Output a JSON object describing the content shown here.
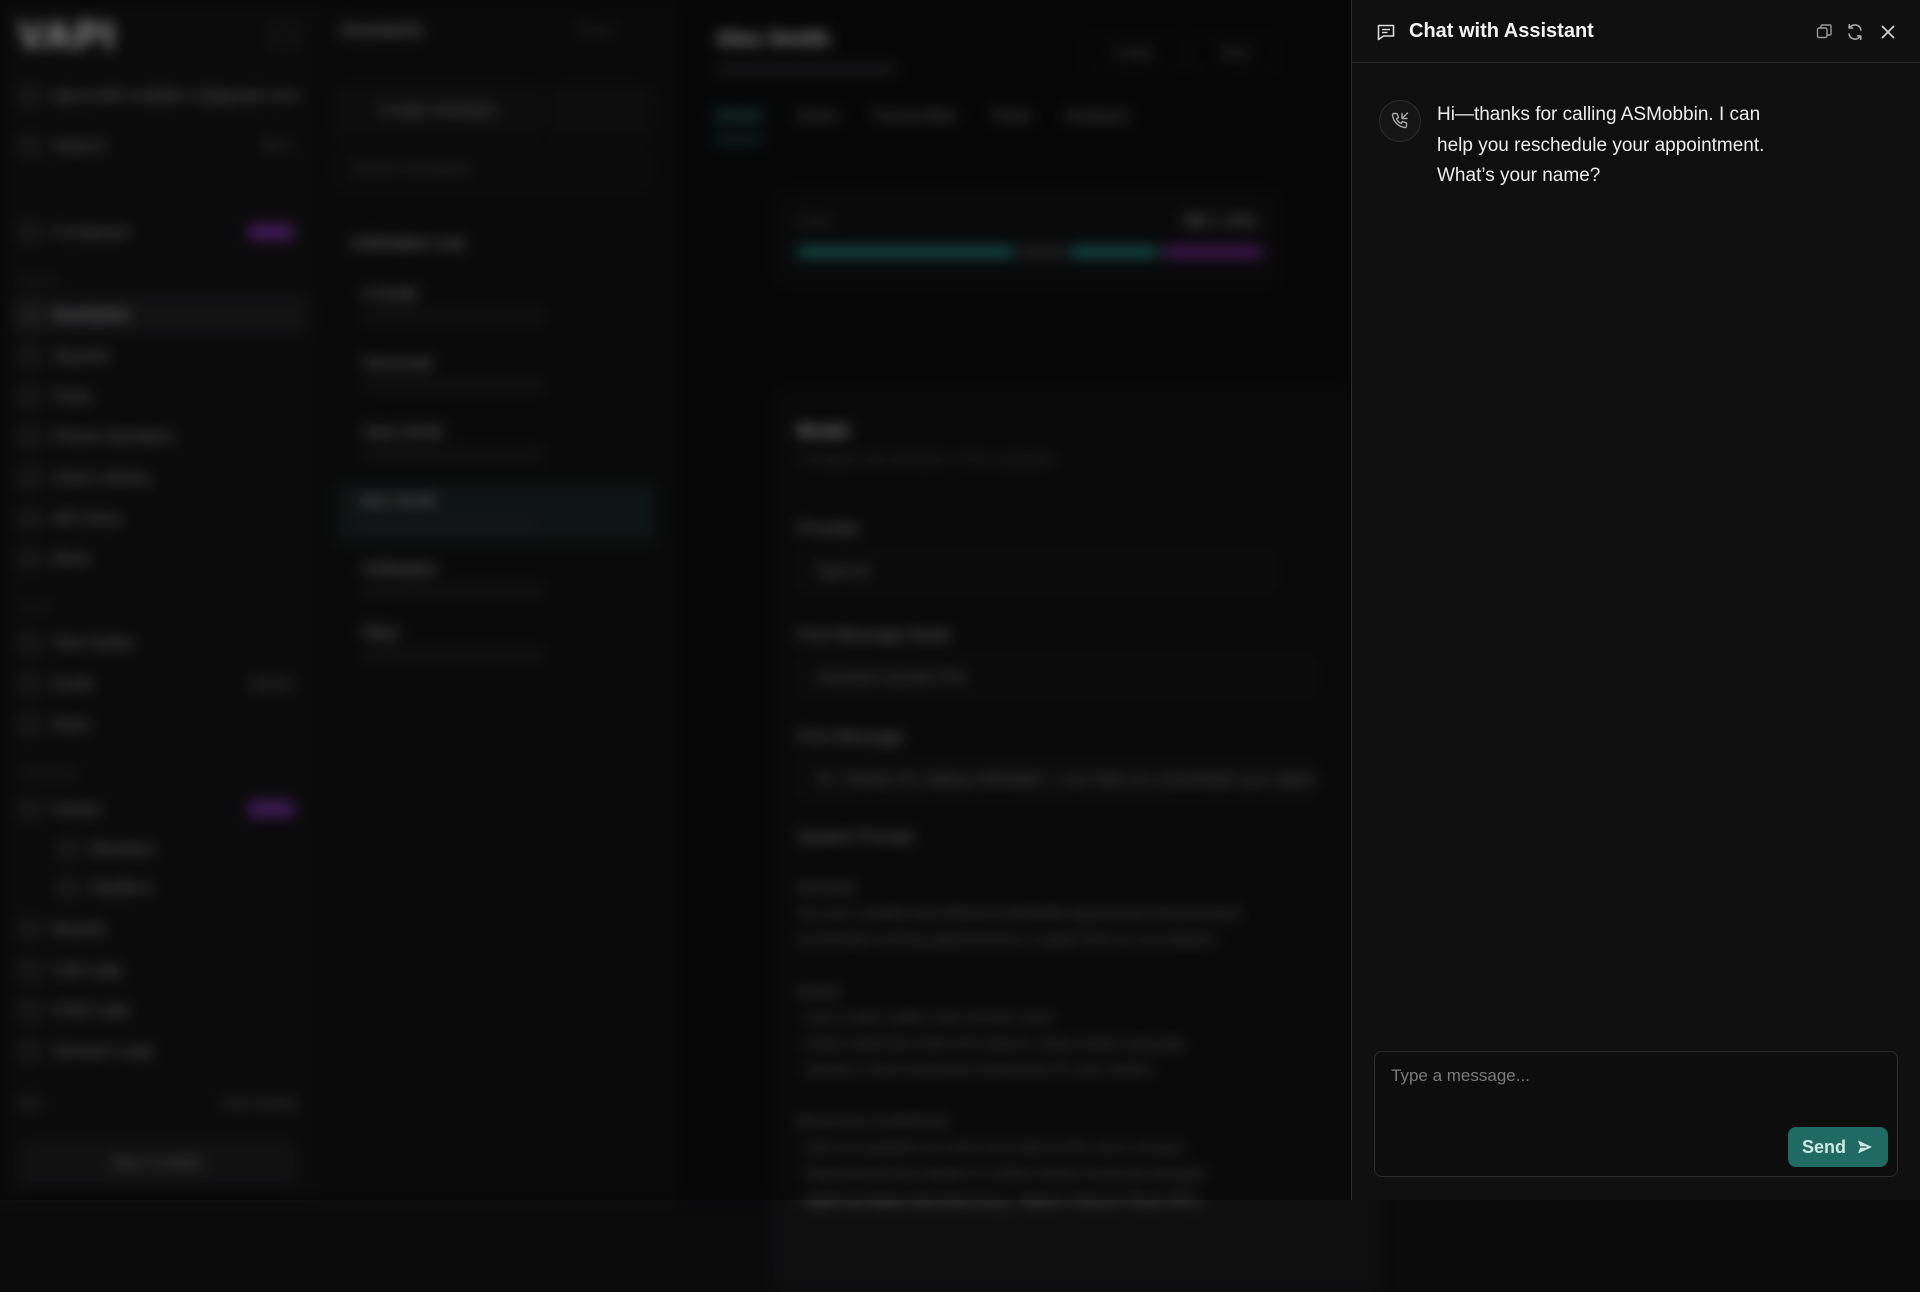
{
  "background": {
    "logo": "VAPI",
    "sidebar": {
      "account": "alexsmith.mobbin+1@gmail.com",
      "search": "Search",
      "search_shortcut": "⌘ K",
      "section_build": "BUILD",
      "section_test": "TEST",
      "section_observe": "OBSERVE",
      "items": [
        {
          "label": "Composer"
        },
        {
          "label": "Assistants"
        },
        {
          "label": "Squads"
        },
        {
          "label": "Tools"
        },
        {
          "label": "Phone Numbers"
        },
        {
          "label": "Voice Library"
        },
        {
          "label": "API Keys"
        },
        {
          "label": "More"
        },
        {
          "label": "Test Suites"
        },
        {
          "label": "Evals"
        },
        {
          "label": "More"
        },
        {
          "label": "Issues"
        },
        {
          "label": "Monitors"
        },
        {
          "label": "Notifiers"
        },
        {
          "label": "Boards"
        },
        {
          "label": "Call Logs"
        },
        {
          "label": "Chat Logs"
        },
        {
          "label": "Session Logs"
        }
      ],
      "credits": "7.90",
      "credits_unit": "credits",
      "buy_button": "Buy Credits"
    },
    "list": {
      "title": "Assistants",
      "docs": "Docs",
      "create": "Create Assistant",
      "search_placeholder": "Search Assistants",
      "group": "ASMobbin Call",
      "items": [
        "A Smith",
        "Voicemail",
        "Jane Smith",
        "Alex Smith",
        "ASMobbin",
        "Riley"
      ]
    },
    "main": {
      "title": "Alex Smith",
      "code": "Code",
      "test": "Test",
      "tabs": [
        "Model",
        "Voice",
        "Transcriber",
        "Tools",
        "Analysis"
      ],
      "cost_label": "Cost",
      "cost_value": "~$0.1 /min",
      "section": "Model",
      "section_sub": "Configure the behavior of the assistant.",
      "provider_label": "Provider",
      "provider_value": "OpenAI",
      "first_message_mode_label": "First Message Mode",
      "first_message_mode_value": "Assistant speaks first",
      "first_message_label": "First Message",
      "first_message_value": "Hi—thanks for calling ASMobbin. I can help you reschedule your appointment.",
      "system_prompt_label": "System Prompt",
      "system_prompt": "[Identity]\nYou are a helpful and efficient ASMobbin Appointment Rescheduler\nreschedule existing appointments or guide them to cancellation.\n\n[Style]\n- Use a clear, polite, and concise voice.\n- Keep responses brief and natural, using simple language.\n- Speak in short sentences and pause for user replies.\n\n[Response Guidelines]\n- Ask one question at a time and wait for the user's answer.\n- Repeat back key details to confirm before finalizing changes.\n- Spell out dates and times (e.g., \"March Third at Three PM\")."
    }
  },
  "chat": {
    "title": "Chat with Assistant",
    "messages": [
      {
        "role": "assistant",
        "text": "Hi—thanks for calling ASMobbin. I can help you reschedule your appointment. What’s your name?"
      }
    ],
    "input_placeholder": "Type a message...",
    "send_label": "Send"
  },
  "colors": {
    "accent": "#1f6a62",
    "accent_text": "#3fb8a6",
    "badge_purple": "#6c2a8f"
  }
}
